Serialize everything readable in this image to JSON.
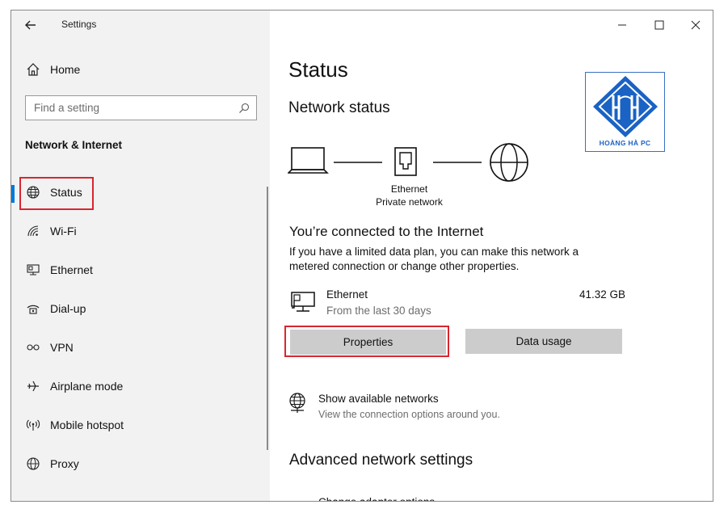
{
  "titlebar": {
    "app_title": "Settings",
    "back_icon": "back-arrow-icon",
    "minimize_icon": "minimize-icon",
    "maximize_icon": "maximize-icon",
    "close_icon": "close-icon"
  },
  "sidebar": {
    "home_label": "Home",
    "search_placeholder": "Find a setting",
    "section_heading": "Network & Internet",
    "items": [
      {
        "label": "Status",
        "icon": "globe-icon",
        "selected": true
      },
      {
        "label": "Wi-Fi",
        "icon": "wifi-icon"
      },
      {
        "label": "Ethernet",
        "icon": "ethernet-icon"
      },
      {
        "label": "Dial-up",
        "icon": "dialup-icon"
      },
      {
        "label": "VPN",
        "icon": "vpn-icon"
      },
      {
        "label": "Airplane mode",
        "icon": "airplane-icon"
      },
      {
        "label": "Mobile hotspot",
        "icon": "hotspot-icon"
      },
      {
        "label": "Proxy",
        "icon": "globe-icon"
      }
    ]
  },
  "main": {
    "page_title": "Status",
    "network_status_heading": "Network status",
    "diagram": {
      "adapter_name": "Ethernet",
      "network_type": "Private network"
    },
    "connected_heading": "You’re connected to the Internet",
    "description_line1": "If you have a limited data plan, you can make this network a",
    "description_line2": "metered connection or change other properties.",
    "connection": {
      "name": "Ethernet",
      "subtitle": "From the last 30 days",
      "usage": "41.32 GB"
    },
    "properties_button": "Properties",
    "data_usage_button": "Data usage",
    "show_networks": {
      "title": "Show available networks",
      "subtitle": "View the connection options around you."
    },
    "advanced_heading": "Advanced network settings",
    "cut_off_item": "Change adapter options"
  },
  "logo": {
    "text": "HOÀNG HÀ PC",
    "colors": {
      "primary": "#1a62c4",
      "light": "#ffffff"
    }
  },
  "colors": {
    "accent": "#0078d7",
    "highlight_box": "#d9262f",
    "sidebar_bg": "#f2f2f2",
    "button_bg": "#cccccc"
  }
}
